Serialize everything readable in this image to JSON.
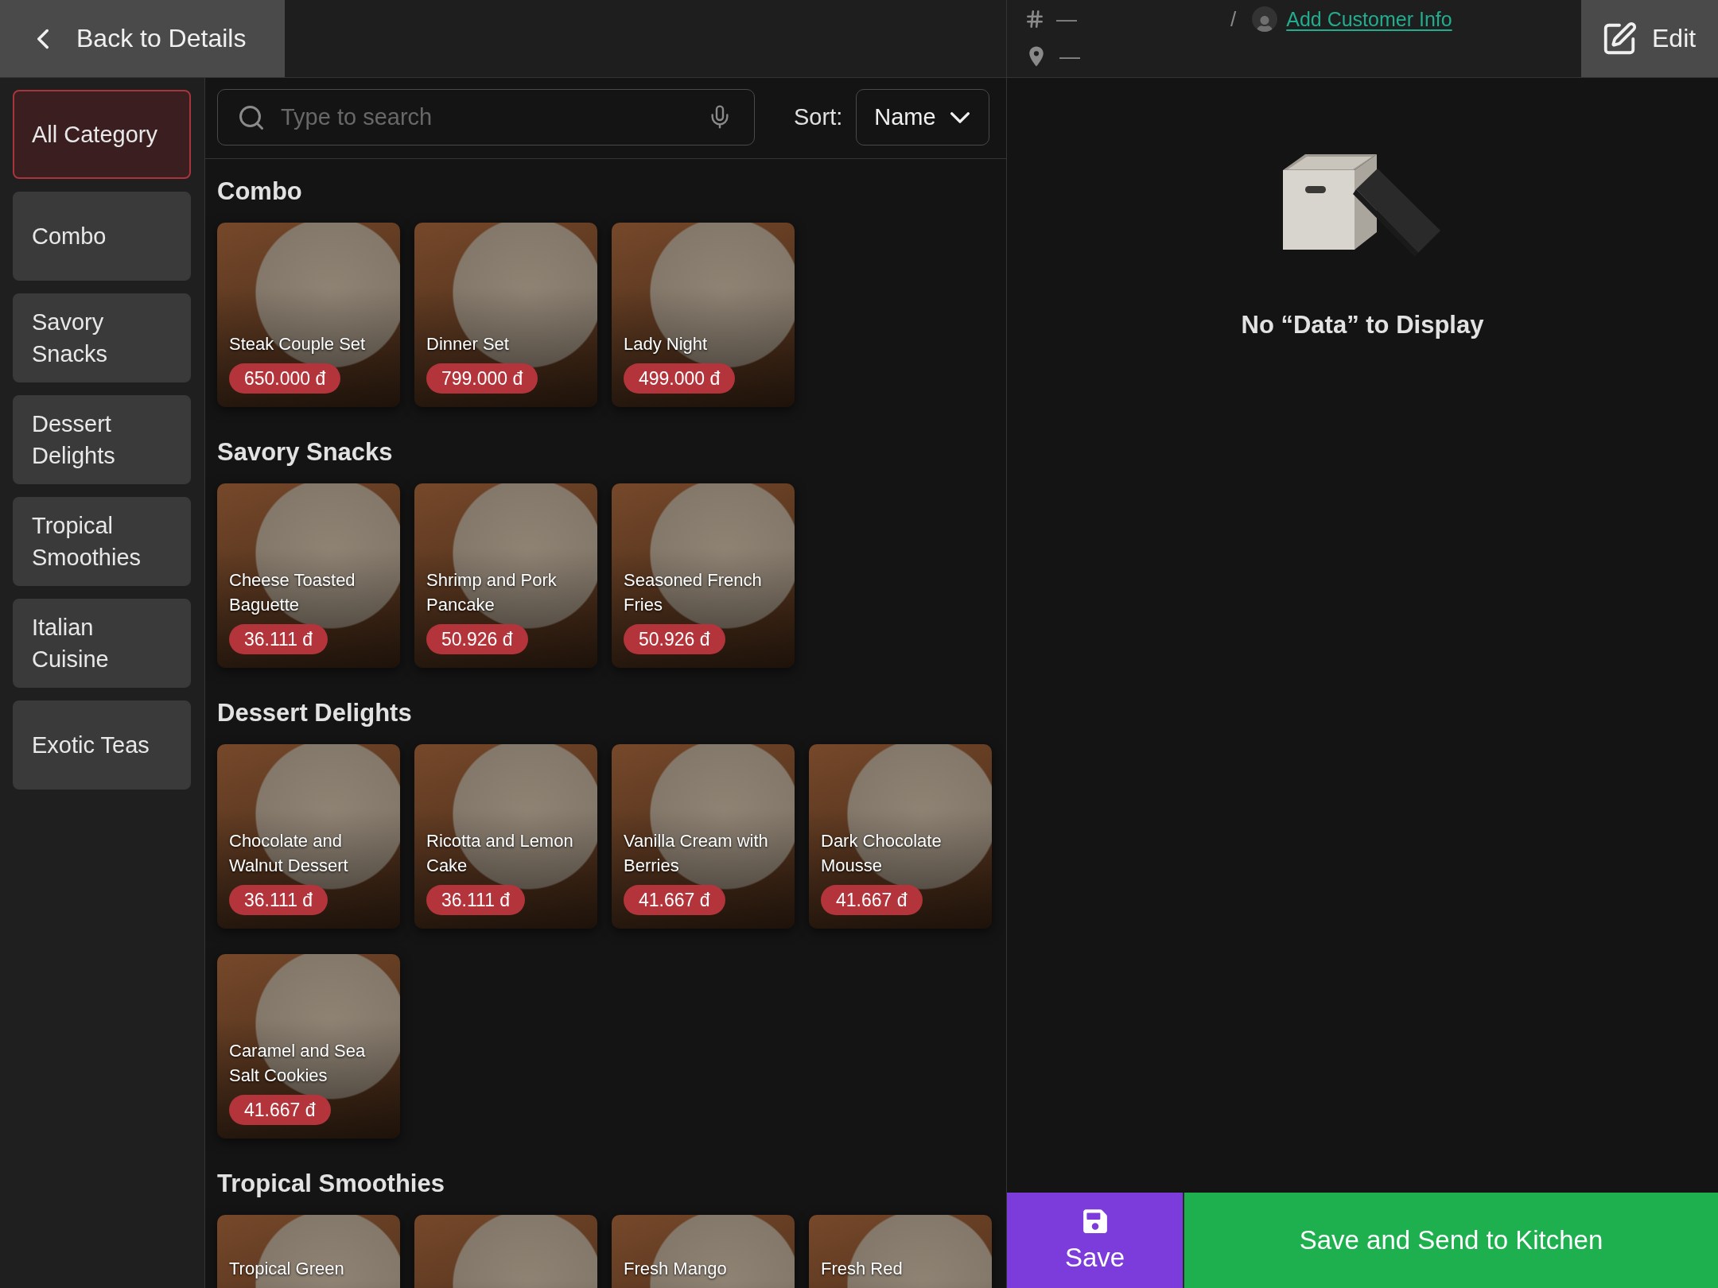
{
  "header": {
    "back_button": "Back to Details",
    "number": "—",
    "location": "—",
    "separator": "/",
    "customer_link": "Add Customer Info",
    "edit_button": "Edit"
  },
  "sidebar": {
    "categories": [
      {
        "label": "All Category",
        "selected": true
      },
      {
        "label": "Combo",
        "selected": false
      },
      {
        "label": "Savory Snacks",
        "selected": false
      },
      {
        "label": "Dessert Delights",
        "selected": false
      },
      {
        "label": "Tropical Smoothies",
        "selected": false
      },
      {
        "label": "Italian Cuisine",
        "selected": false
      },
      {
        "label": "Exotic Teas",
        "selected": false
      }
    ]
  },
  "toolbar": {
    "search": {
      "placeholder": "Type to search"
    },
    "sort_label": "Sort:",
    "sort_value": "Name"
  },
  "sections": [
    {
      "title": "Combo",
      "items": [
        {
          "name": "Steak Couple Set",
          "price": "650.000 đ",
          "photo": true
        },
        {
          "name": "Dinner Set",
          "price": "799.000 đ",
          "photo": true
        },
        {
          "name": "Lady Night",
          "price": "499.000 đ",
          "photo": true
        }
      ]
    },
    {
      "title": "Savory Snacks",
      "items": [
        {
          "name": "Cheese Toasted Baguette",
          "price": "36.111 đ",
          "photo": true
        },
        {
          "name": "Shrimp and Pork Pancake",
          "price": "50.926 đ",
          "photo": true
        },
        {
          "name": "Seasoned French Fries",
          "price": "50.926 đ",
          "photo": true
        }
      ]
    },
    {
      "title": "Dessert Delights",
      "items": [
        {
          "name": "Chocolate and Walnut Dessert",
          "price": "36.111 đ",
          "photo": true
        },
        {
          "name": "Ricotta and Lemon Cake",
          "price": "36.111 đ",
          "photo": true
        },
        {
          "name": "Vanilla Cream with Berries",
          "price": "41.667 đ",
          "photo": true
        },
        {
          "name": "Dark Chocolate Mousse",
          "price": "41.667 đ",
          "photo": true
        },
        {
          "name": "Caramel and Sea Salt Cookies",
          "price": "41.667 đ",
          "photo": true
        }
      ]
    },
    {
      "title": "Tropical Smoothies",
      "items": [
        {
          "name": "Tropical Green",
          "photo": true
        },
        {
          "photo": true
        },
        {
          "name": "Fresh Mango",
          "photo": true
        },
        {
          "name": "Fresh Red",
          "photo": true
        }
      ]
    }
  ],
  "order_panel": {
    "empty_message": "No “Data” to Display"
  },
  "actions": [
    {
      "kind": "save",
      "label": "Save"
    },
    {
      "kind": "send",
      "label": "Save and Send to Kitchen"
    }
  ]
}
